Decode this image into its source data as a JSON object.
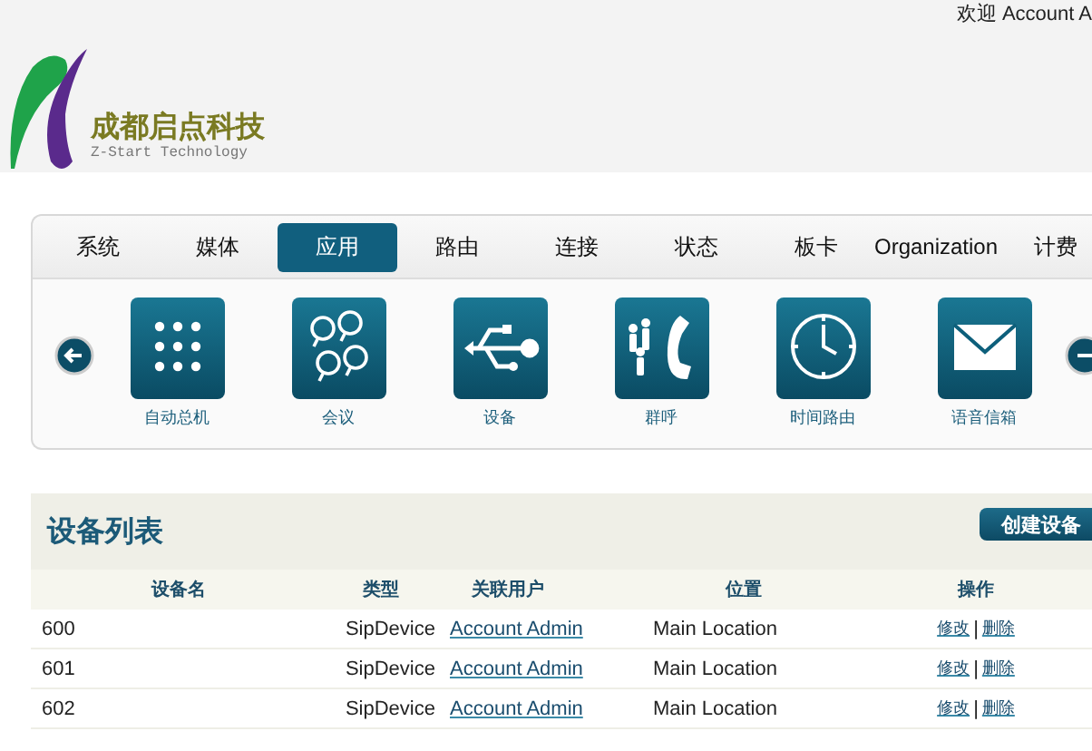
{
  "header": {
    "logo": {
      "name": "成都启点科技",
      "tagline": "Z-Start Technology"
    },
    "welcome": "欢迎 Account A"
  },
  "nav": {
    "tabs": [
      {
        "label": "系统",
        "selected": false
      },
      {
        "label": "媒体",
        "selected": false
      },
      {
        "label": "应用",
        "selected": true
      },
      {
        "label": "路由",
        "selected": false
      },
      {
        "label": "连接",
        "selected": false
      },
      {
        "label": "状态",
        "selected": false
      },
      {
        "label": "板卡",
        "selected": false
      },
      {
        "label": "Organization",
        "selected": false
      },
      {
        "label": "计费",
        "selected": false
      }
    ],
    "apps": [
      {
        "label": "自动总机",
        "kind": "keypad"
      },
      {
        "label": "会议",
        "kind": "chat"
      },
      {
        "label": "设备",
        "kind": "usb"
      },
      {
        "label": "群呼",
        "kind": "group-call"
      },
      {
        "label": "时间路由",
        "kind": "clock"
      },
      {
        "label": "语音信箱",
        "kind": "mail"
      }
    ]
  },
  "device_list": {
    "title": "设备列表",
    "create_button": "创建设备",
    "columns": [
      "设备名",
      "类型",
      "关联用户",
      "位置",
      "操作"
    ],
    "action_separator": "|",
    "rows": [
      {
        "name": "600",
        "type": "SipDevice",
        "user": "Account Admin",
        "location": "Main Location",
        "actions": [
          "修改",
          "删除"
        ]
      },
      {
        "name": "601",
        "type": "SipDevice",
        "user": "Account Admin",
        "location": "Main Location",
        "actions": [
          "修改",
          "删除"
        ]
      },
      {
        "name": "602",
        "type": "SipDevice",
        "user": "Account Admin",
        "location": "Main Location",
        "actions": [
          "修改",
          "删除"
        ]
      }
    ]
  }
}
